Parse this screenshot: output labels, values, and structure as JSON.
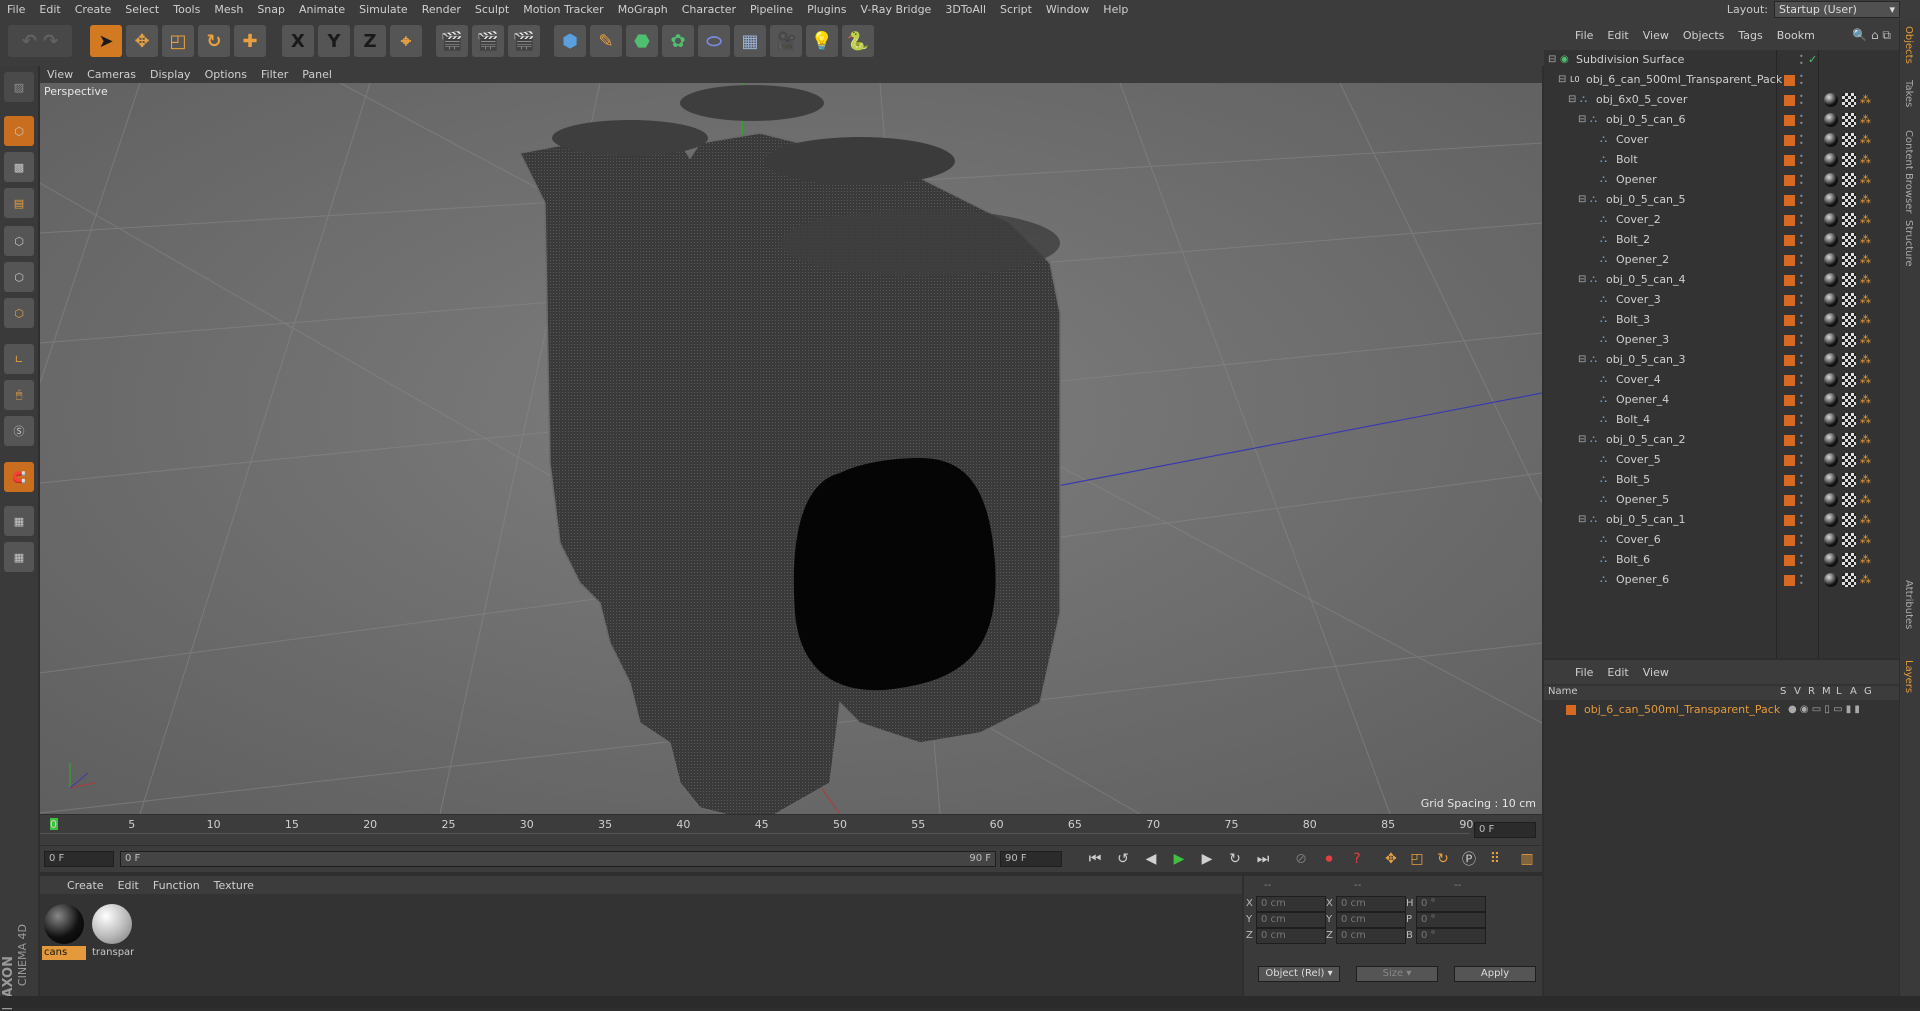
{
  "menubar": {
    "items": [
      "File",
      "Edit",
      "Create",
      "Select",
      "Tools",
      "Mesh",
      "Snap",
      "Animate",
      "Simulate",
      "Render",
      "Sculpt",
      "Motion Tracker",
      "MoGraph",
      "Character",
      "Pipeline",
      "Plugins",
      "V-Ray Bridge",
      "3DToAll",
      "Script",
      "Window",
      "Help"
    ],
    "layout_label": "Layout:",
    "layout_value": "Startup (User)"
  },
  "toolbar": {
    "axis_x": "X",
    "axis_y": "Y",
    "axis_z": "Z"
  },
  "viewport": {
    "menu": [
      "View",
      "Cameras",
      "Display",
      "Options",
      "Filter",
      "Panel"
    ],
    "label": "Perspective",
    "grid_spacing": "Grid Spacing : 10 cm"
  },
  "timeline": {
    "ticks": [
      "0",
      "5",
      "10",
      "15",
      "20",
      "25",
      "30",
      "35",
      "40",
      "45",
      "50",
      "55",
      "60",
      "65",
      "70",
      "75",
      "80",
      "85",
      "90"
    ],
    "current_frame": "0 F",
    "start_field": "0 F",
    "range_start": "0 F",
    "range_end": "90 F",
    "end_field": "90 F"
  },
  "materials": {
    "menu": [
      "Create",
      "Edit",
      "Function",
      "Texture"
    ],
    "items": [
      {
        "label": "cans",
        "color": "#1a1a1a",
        "selected": true
      },
      {
        "label": "transpar",
        "color": "#b8b8b8",
        "selected": false
      }
    ]
  },
  "coordinates": {
    "head1": "--",
    "head2": "--",
    "head3": "--",
    "rows": [
      {
        "a": "X",
        "av": "0 cm",
        "b": "X",
        "bv": "0 cm",
        "c": "H",
        "cv": "0 °"
      },
      {
        "a": "Y",
        "av": "0 cm",
        "b": "Y",
        "bv": "0 cm",
        "c": "P",
        "cv": "0 °"
      },
      {
        "a": "Z",
        "av": "0 cm",
        "b": "Z",
        "bv": "0 cm",
        "c": "B",
        "cv": "0 °"
      }
    ],
    "mode": "Object (Rel)",
    "size": "Size",
    "apply": "Apply"
  },
  "objects": {
    "menu": [
      "File",
      "Edit",
      "View",
      "Objects",
      "Tags",
      "Bookm"
    ],
    "tree": [
      {
        "name": "Subdivision Surface",
        "depth": 0
      },
      {
        "name": "obj_6_can_500ml_Transparent_Pack",
        "depth": 1
      },
      {
        "name": "obj_6x0_5_cover",
        "depth": 2
      },
      {
        "name": "obj_0_5_can_6",
        "depth": 3
      },
      {
        "name": "Cover",
        "depth": 4
      },
      {
        "name": "Bolt",
        "depth": 4
      },
      {
        "name": "Opener",
        "depth": 4
      },
      {
        "name": "obj_0_5_can_5",
        "depth": 3
      },
      {
        "name": "Cover_2",
        "depth": 4
      },
      {
        "name": "Bolt_2",
        "depth": 4
      },
      {
        "name": "Opener_2",
        "depth": 4
      },
      {
        "name": "obj_0_5_can_4",
        "depth": 3
      },
      {
        "name": "Cover_3",
        "depth": 4
      },
      {
        "name": "Bolt_3",
        "depth": 4
      },
      {
        "name": "Opener_3",
        "depth": 4
      },
      {
        "name": "obj_0_5_can_3",
        "depth": 3
      },
      {
        "name": "Cover_4",
        "depth": 4
      },
      {
        "name": "Opener_4",
        "depth": 4
      },
      {
        "name": "Bolt_4",
        "depth": 4
      },
      {
        "name": "obj_0_5_can_2",
        "depth": 3
      },
      {
        "name": "Cover_5",
        "depth": 4
      },
      {
        "name": "Bolt_5",
        "depth": 4
      },
      {
        "name": "Opener_5",
        "depth": 4
      },
      {
        "name": "obj_0_5_can_1",
        "depth": 3
      },
      {
        "name": "Cover_6",
        "depth": 4
      },
      {
        "name": "Bolt_6",
        "depth": 4
      },
      {
        "name": "Opener_6",
        "depth": 4
      }
    ]
  },
  "layers": {
    "menu": [
      "File",
      "Edit",
      "View"
    ],
    "header_name": "Name",
    "columns": [
      "S",
      "V",
      "R",
      "M",
      "L",
      "A",
      "G"
    ],
    "row_name": "obj_6_can_500ml_Transparent_Pack"
  },
  "right_tabs": [
    "Objects",
    "Takes",
    "Content Browser",
    "Structure",
    "Attributes",
    "Layers"
  ],
  "brand": {
    "line1": "MAXON",
    "line2": "CINEMA 4D"
  },
  "colors": {
    "accent": "#d66a22",
    "selected_text": "#e49a3c"
  }
}
